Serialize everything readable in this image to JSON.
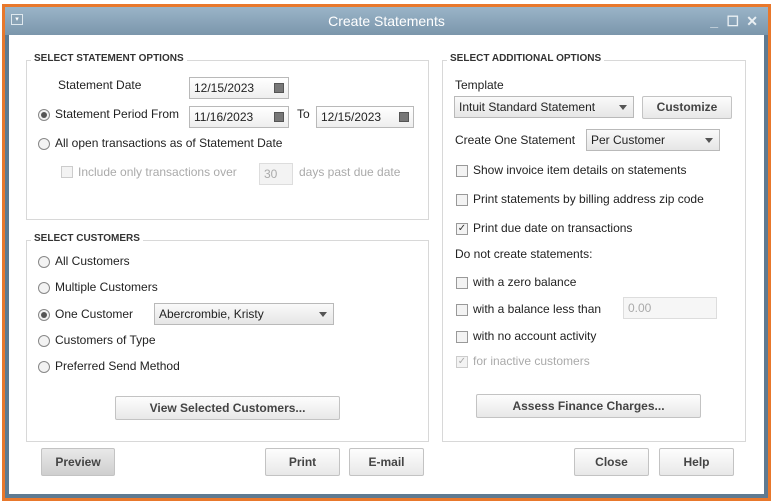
{
  "window": {
    "title": "Create Statements"
  },
  "statement_options": {
    "heading": "SELECT STATEMENT OPTIONS",
    "statement_date_label": "Statement Date",
    "statement_date": "12/15/2023",
    "period_label": "Statement Period From",
    "period_from": "11/16/2023",
    "to_label": "To",
    "period_to": "12/15/2023",
    "all_open_label": "All open transactions as of Statement Date",
    "include_only_label": "Include only transactions over",
    "days_value": "30",
    "days_label": "days past due date"
  },
  "customers": {
    "heading": "SELECT CUSTOMERS",
    "all": "All Customers",
    "multiple": "Multiple Customers",
    "one": "One Customer",
    "one_value": "Abercrombie, Kristy",
    "of_type": "Customers of Type",
    "preferred": "Preferred Send Method",
    "view_button": "View Selected Customers..."
  },
  "additional": {
    "heading": "SELECT ADDITIONAL OPTIONS",
    "template_label": "Template",
    "template_value": "Intuit Standard Statement",
    "customize": "Customize",
    "create_one_label": "Create One Statement",
    "create_one_value": "Per Customer",
    "show_details": "Show invoice item details on statements",
    "print_zip": "Print statements by billing address zip code",
    "print_due": "Print due date on transactions",
    "do_not_create": "Do not create statements:",
    "zero_balance": "with a zero balance",
    "balance_less": "with a balance less than",
    "balance_value": "0.00",
    "no_activity": "with no account activity",
    "inactive": "for inactive customers",
    "assess_button": "Assess Finance Charges..."
  },
  "buttons": {
    "preview": "Preview",
    "print": "Print",
    "email": "E-mail",
    "close": "Close",
    "help": "Help"
  }
}
